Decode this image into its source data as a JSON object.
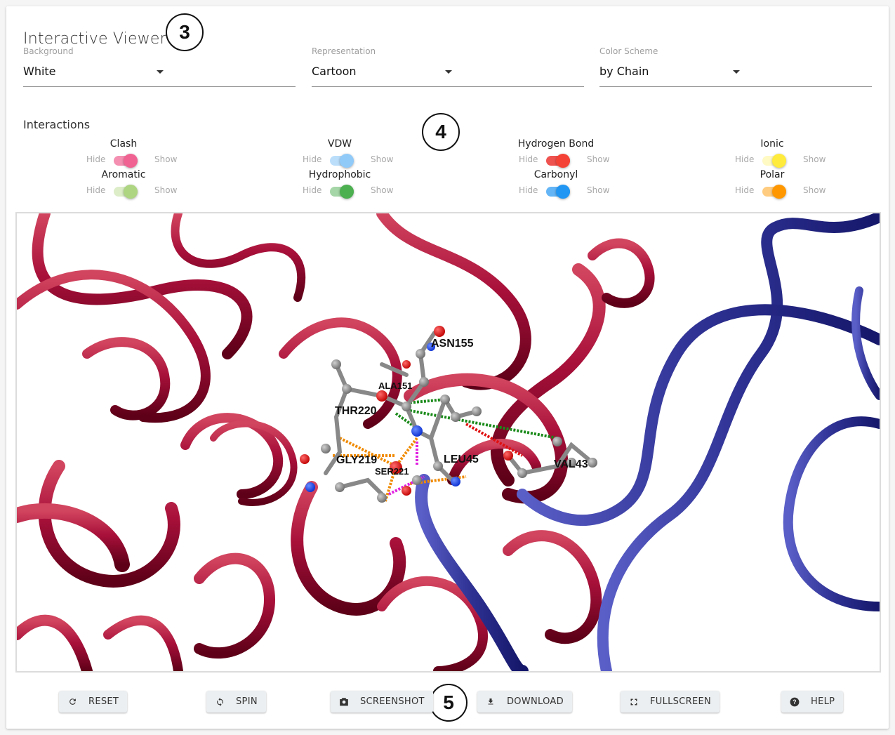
{
  "header": {
    "title": "Interactive Viewer"
  },
  "callouts": {
    "c3": "3",
    "c4": "4",
    "c5": "5"
  },
  "selects": [
    {
      "label": "Background",
      "value": "White"
    },
    {
      "label": "Representation",
      "value": "Cartoon"
    },
    {
      "label": "Color Scheme",
      "value": "by Chain"
    }
  ],
  "interactions": {
    "title": "Interactions",
    "hide_label": "Hide",
    "show_label": "Show",
    "toggles": [
      {
        "name": "Clash",
        "state": "show",
        "thumb_color": "#f06292",
        "track_color": "#f48fb1"
      },
      {
        "name": "VDW",
        "state": "show",
        "thumb_color": "#90caf9",
        "track_color": "#bbdefb"
      },
      {
        "name": "Hydrogen Bond",
        "state": "show",
        "thumb_color": "#f44336",
        "track_color": "#ef5350"
      },
      {
        "name": "Ionic",
        "state": "show",
        "thumb_color": "#ffeb3b",
        "track_color": "#fff9c4"
      },
      {
        "name": "Aromatic",
        "state": "show",
        "thumb_color": "#aed581",
        "track_color": "#dcedc8"
      },
      {
        "name": "Hydrophobic",
        "state": "show",
        "thumb_color": "#4caf50",
        "track_color": "#a5d6a7"
      },
      {
        "name": "Carbonyl",
        "state": "show",
        "thumb_color": "#2196f3",
        "track_color": "#64b5f6"
      },
      {
        "name": "Polar",
        "state": "show",
        "thumb_color": "#ff9800",
        "track_color": "#ffcc80"
      }
    ]
  },
  "viewer": {
    "chain_colors": {
      "chain_a": "#a8103a",
      "chain_b": "#2e3192"
    },
    "residue_labels": [
      "ASN155",
      "ALA151",
      "THR220",
      "GLY219",
      "LEU45",
      "VAL43",
      "SER221"
    ]
  },
  "toolbar": {
    "buttons": [
      {
        "label": "RESET",
        "icon": "refresh-icon"
      },
      {
        "label": "SPIN",
        "icon": "sync-icon"
      },
      {
        "label": "SCREENSHOT",
        "icon": "camera-icon"
      },
      {
        "label": "DOWNLOAD",
        "icon": "download-icon"
      },
      {
        "label": "FULLSCREEN",
        "icon": "fullscreen-icon"
      },
      {
        "label": "HELP",
        "icon": "help-icon"
      }
    ]
  }
}
